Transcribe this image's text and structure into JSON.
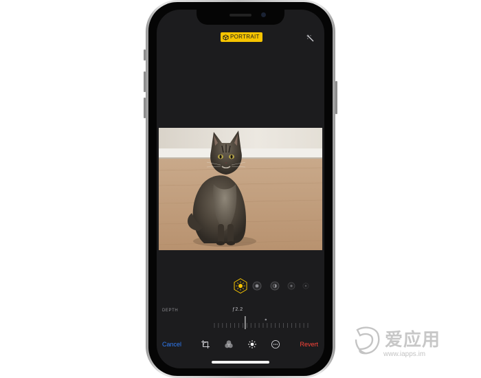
{
  "mode_badge": {
    "label": "PORTRAIT",
    "icon": "cube-icon",
    "color": "#f6c400"
  },
  "top_right": {
    "icon": "magic-wand-icon"
  },
  "photo": {
    "subject": "cat"
  },
  "lighting": {
    "selected_index": 0,
    "options": [
      {
        "icon": "natural-light-icon"
      },
      {
        "icon": "studio-light-icon"
      },
      {
        "icon": "contour-light-icon"
      },
      {
        "icon": "stage-light-icon"
      },
      {
        "icon": "stage-light-mono-icon"
      }
    ]
  },
  "depth": {
    "label": "DEPTH",
    "value_text": "ƒ2.2",
    "slider_level": 0.33
  },
  "toolbar": {
    "cancel_label": "Cancel",
    "revert_label": "Revert",
    "cancel_color": "#2f7cf6",
    "revert_color": "#ff453a",
    "tools": [
      "crop-icon",
      "filters-icon",
      "lighting-adjust-icon",
      "more-icon"
    ]
  },
  "watermark": {
    "title": "爱应用",
    "url": "www.iapps.im"
  }
}
